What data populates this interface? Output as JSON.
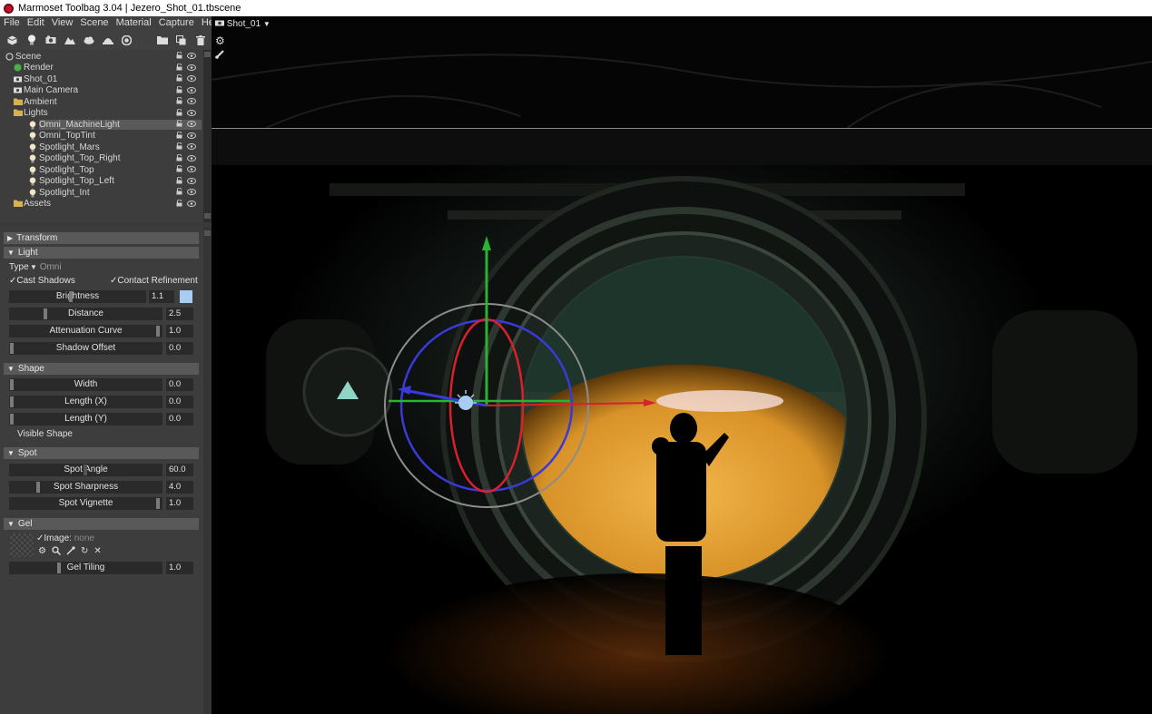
{
  "window": {
    "title": "Marmoset Toolbag 3.04  |  Jezero_Shot_01.tbscene"
  },
  "menu": [
    "File",
    "Edit",
    "View",
    "Scene",
    "Material",
    "Capture",
    "Help"
  ],
  "toolbar_icons": [
    "cube-icon",
    "bulb-icon",
    "camera-icon",
    "terrain-icon",
    "cloud-icon",
    "hat-icon",
    "globe-icon",
    "folder-icon",
    "duplicate-icon",
    "trash-icon"
  ],
  "outliner": {
    "items": [
      {
        "label": "Scene",
        "indent": 0,
        "icon": "scene-icon",
        "type": "root"
      },
      {
        "label": "Render",
        "indent": 1,
        "icon": "render-icon"
      },
      {
        "label": "Shot_01",
        "indent": 1,
        "icon": "camera-icon"
      },
      {
        "label": "Main Camera",
        "indent": 1,
        "icon": "camera-icon"
      },
      {
        "label": "Ambient",
        "indent": 1,
        "icon": "folder-icon"
      },
      {
        "label": "Lights",
        "indent": 1,
        "icon": "folder-icon"
      },
      {
        "label": "Omni_MachineLight",
        "indent": 2,
        "icon": "bulb-icon",
        "selected": true
      },
      {
        "label": "Omni_TopTint",
        "indent": 2,
        "icon": "bulb-icon"
      },
      {
        "label": "Spotlight_Mars",
        "indent": 2,
        "icon": "bulb-icon"
      },
      {
        "label": "Spotlight_Top_Right",
        "indent": 2,
        "icon": "bulb-icon"
      },
      {
        "label": "Spotlight_Top",
        "indent": 2,
        "icon": "bulb-icon"
      },
      {
        "label": "Spotlight_Top_Left",
        "indent": 2,
        "icon": "bulb-icon"
      },
      {
        "label": "Spotlight_Int",
        "indent": 2,
        "icon": "bulb-icon"
      },
      {
        "label": "Assets",
        "indent": 1,
        "icon": "folder-icon"
      }
    ]
  },
  "properties": {
    "transform": "Transform",
    "light": "Light",
    "type_label": "Type",
    "type_value": "Omni",
    "cast_shadows": "Cast Shadows",
    "contact_refinement": "Contact Refinement",
    "brightness_label": "Brightness",
    "brightness_value": "1.1",
    "light_color": "#a9cdf2",
    "distance_label": "Distance",
    "distance_value": "2.5",
    "attenuation_label": "Attenuation Curve",
    "attenuation_value": "1.0",
    "shadow_offset_label": "Shadow Offset",
    "shadow_offset_value": "0.0",
    "shape": "Shape",
    "width_label": "Width",
    "width_value": "0.0",
    "length_x_label": "Length (X)",
    "length_x_value": "0.0",
    "length_y_label": "Length (Y)",
    "length_y_value": "0.0",
    "visible_shape": "Visible Shape",
    "spot": "Spot",
    "spot_angle_label": "Spot Angle",
    "spot_angle_value": "60.0",
    "spot_sharpness_label": "Spot Sharpness",
    "spot_sharpness_value": "4.0",
    "spot_vignette_label": "Spot Vignette",
    "spot_vignette_value": "1.0",
    "gel": "Gel",
    "image_label": "Image:",
    "image_value": "none",
    "gel_tiling_label": "Gel Tiling",
    "gel_tiling_value": "1.0"
  },
  "viewport": {
    "camera_label": "Shot_01"
  }
}
